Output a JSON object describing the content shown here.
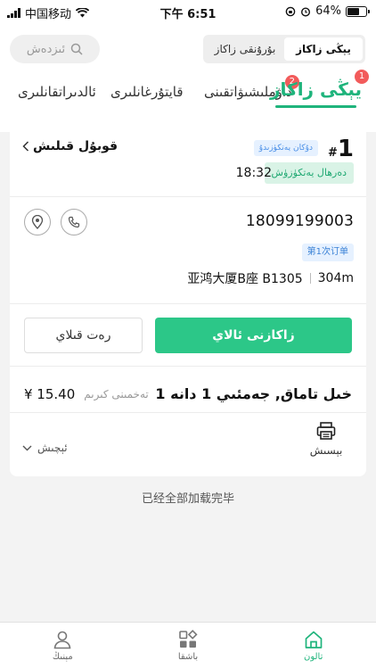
{
  "status_bar": {
    "carrier": "中国移动",
    "time": "下午 6:51",
    "battery": "64%",
    "battery_level": 0.64
  },
  "header": {
    "search_label": "ئىزدەش",
    "segment": [
      "يېڭى زاكاز",
      "بۇرۇنقى زاكاز"
    ],
    "tabs": [
      {
        "label": "يېڭى زاكاز",
        "badge": "1"
      },
      {
        "label": "داۋملىشىۋاتقىنى",
        "badge": "2"
      },
      {
        "label": "قايتۇرغانلىرى",
        "badge": ""
      },
      {
        "label": "ئالدىراتقانلىرى",
        "badge": ""
      }
    ]
  },
  "order": {
    "number": "1",
    "hash": "#",
    "shop_tag": "دۇكان يەتكۈزىدۇ",
    "status_tag": "دەرھال يەتكۈزۈش",
    "time": "18:32",
    "delivery_label": "قوبۇل قىلىش",
    "phone": "18099199003",
    "visit_tag": "第1次订单",
    "address": "亚鸿大厦B座 B1305",
    "distance": "304m",
    "reject_label": "رەت قىلاي",
    "accept_label": "زاكازنى ئالاي",
    "item_name": "1 خىل تاماق, جەمئىي 1 دانە",
    "price_label": "تەخمىنى كىرىم",
    "price": "¥ 15.40",
    "expand_label": "ئېچىش",
    "print_label": "بېسىش"
  },
  "footer_text": "已经全部加载完毕",
  "bottom_nav": [
    {
      "label": "مېنىڭ",
      "icon": "person-icon"
    },
    {
      "label": "باشقا",
      "icon": "apps-icon"
    },
    {
      "label": "تالون",
      "icon": "home-icon"
    }
  ],
  "colors": {
    "accent": "#1fb47c",
    "accept_button": "#2cc788",
    "badge": "#f25b5b",
    "tag_blue": "#4a8fe7"
  }
}
